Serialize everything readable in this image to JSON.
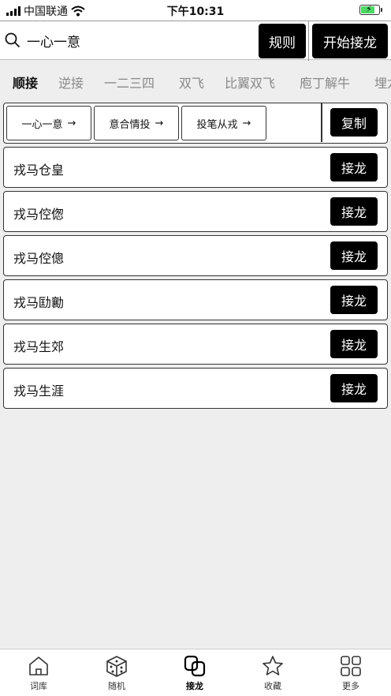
{
  "status_bar": {
    "carrier": "中国联通",
    "time": "下午10:31"
  },
  "search": {
    "value": "一心一意",
    "placeholder": ""
  },
  "header": {
    "rules_label": "规则",
    "start_label": "开始接龙"
  },
  "tabs": [
    {
      "label": "顺接",
      "active": true
    },
    {
      "label": "逆接",
      "active": false
    },
    {
      "label": "一二三四",
      "active": false
    },
    {
      "label": "双飞",
      "active": false
    },
    {
      "label": "比翼双飞",
      "active": false
    },
    {
      "label": "庖丁解牛",
      "active": false
    },
    {
      "label": "埋龙",
      "active": false
    }
  ],
  "chain": {
    "items": [
      {
        "label": "一心一意",
        "arrow": "→"
      },
      {
        "label": "意合情投",
        "arrow": "→"
      },
      {
        "label": "投笔从戎",
        "arrow": "→"
      }
    ],
    "copy_label": "复制"
  },
  "results": [
    {
      "text": "戎马仓皇",
      "button": "接龙"
    },
    {
      "text": "戎马倥偬",
      "button": "接龙"
    },
    {
      "text": "戎马倥傯",
      "button": "接龙"
    },
    {
      "text": "戎马劻勷",
      "button": "接龙"
    },
    {
      "text": "戎马生郊",
      "button": "接龙"
    },
    {
      "text": "戎马生涯",
      "button": "接龙"
    }
  ],
  "bottom_nav": [
    {
      "label": "词库",
      "icon": "home-icon"
    },
    {
      "label": "随机",
      "icon": "dice-icon"
    },
    {
      "label": "接龙",
      "icon": "chain-icon",
      "active": true
    },
    {
      "label": "收藏",
      "icon": "star-icon"
    },
    {
      "label": "更多",
      "icon": "grid-icon"
    }
  ]
}
